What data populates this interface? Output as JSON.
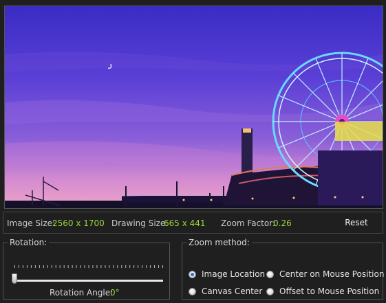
{
  "info_bar": {
    "image_size_label": "Image Size:",
    "image_size_value": "2560 x 1700",
    "drawing_size_label": "Drawing Size:",
    "drawing_size_value": "665 x 441",
    "zoom_factor_label": "Zoom Factor:",
    "zoom_factor_value": "0.26",
    "reset_label": "Reset"
  },
  "rotation": {
    "title": "Rotation:",
    "angle_label": "Rotation Angle:",
    "angle_value": "0°",
    "slider_value": 0
  },
  "zoom_method": {
    "title": "Zoom method:",
    "options": [
      {
        "label": "Image Location",
        "selected": true
      },
      {
        "label": "Center on Mouse Position",
        "selected": false
      },
      {
        "label": "Canvas Center",
        "selected": false
      },
      {
        "label": "Offset to Mouse Position",
        "selected": false
      }
    ]
  },
  "colors": {
    "value_green": "#9cd83a",
    "background": "#1f1f1f",
    "radio_accent": "#2b6fd6"
  }
}
